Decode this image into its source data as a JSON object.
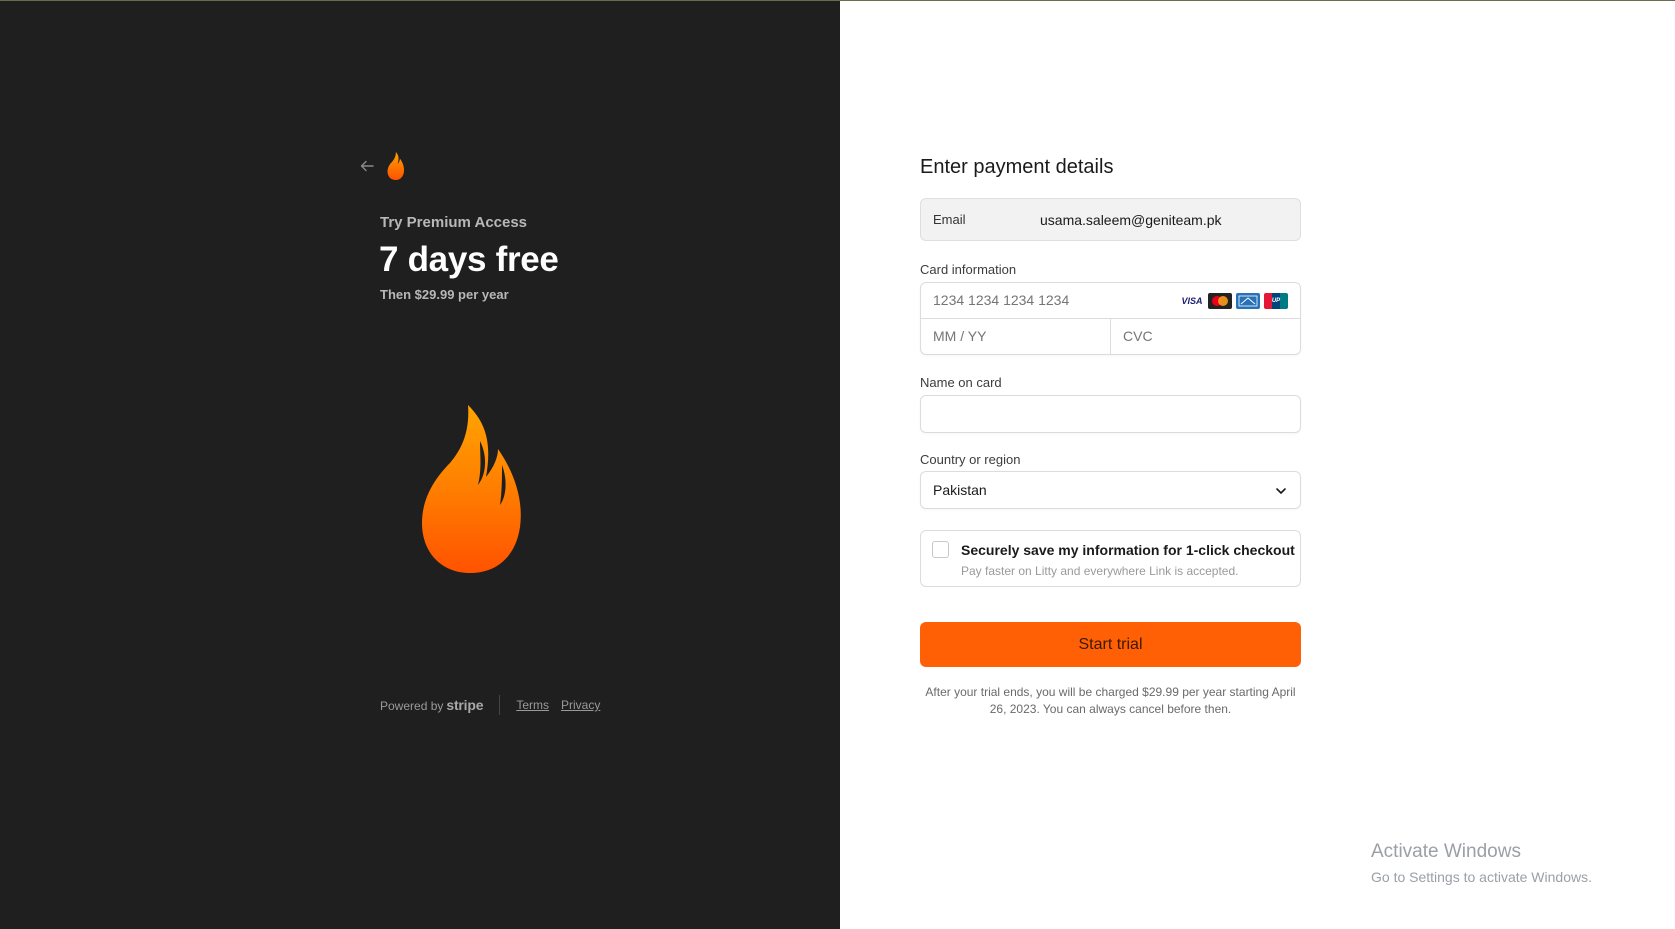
{
  "left_panel": {
    "plan_label": "Try Premium Access",
    "plan_price": "7 days free",
    "plan_then": "Then $29.99 per year",
    "footer": {
      "powered_by": "Powered by",
      "stripe": "stripe",
      "terms": "Terms",
      "privacy": "Privacy"
    },
    "icons": {
      "back": "back-arrow-icon",
      "logo": "flame-logo-icon"
    }
  },
  "form": {
    "title": "Enter payment details",
    "email": {
      "label": "Email",
      "value": "usama.saleem@geniteam.pk"
    },
    "card": {
      "label": "Card information",
      "number_placeholder": "1234 1234 1234 1234",
      "expiry_placeholder": "MM / YY",
      "cvc_placeholder": "CVC",
      "brands": [
        "VISA",
        "Mastercard",
        "AMEX",
        "UnionPay"
      ]
    },
    "name_on_card": {
      "label": "Name on card",
      "value": ""
    },
    "country": {
      "label": "Country or region",
      "selected": "Pakistan"
    },
    "save_info": {
      "checked": false,
      "title": "Securely save my information for 1-click checkout",
      "subtitle": "Pay faster on Litty and everywhere Link is accepted."
    },
    "submit_label": "Start trial",
    "terms_text": "After your trial ends, you will be charged $29.99 per year starting April 26, 2023. You can always cancel before then."
  },
  "watermark": {
    "title": "Activate Windows",
    "subtitle": "Go to Settings to activate Windows."
  },
  "colors": {
    "left_bg": "#1f1f20",
    "accent": "#ff6005",
    "flame_top": "#ffa000",
    "flame_bottom": "#ff5a00"
  }
}
